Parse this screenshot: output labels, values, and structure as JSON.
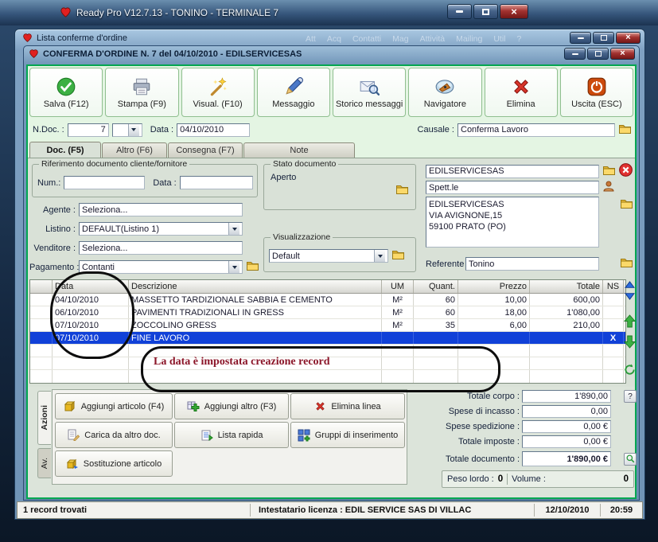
{
  "colors": {
    "accent_green": "#00a651",
    "selected_row": "#1141d8",
    "annotation_red": "#8b1528"
  },
  "outer_window": {
    "title": "Ready Pro V12.7.13 - TONINO - TERMINALE 7"
  },
  "list_window": {
    "title": "Lista conferme d'ordine",
    "ghost_menu": [
      "Att",
      "Acq",
      "Contatti",
      "Mag",
      "Attività",
      "Mailing",
      "Util",
      "?"
    ]
  },
  "doc_window": {
    "title": "CONFERMA D'ORDINE N. 7  del 04/10/2010 - EDILSERVICESAS"
  },
  "toolbar": {
    "buttons": [
      {
        "label": "Salva (F12)",
        "icon": "save-check-icon"
      },
      {
        "label": "Stampa (F9)",
        "icon": "printer-icon"
      },
      {
        "label": "Visual. (F10)",
        "icon": "magic-wand-icon"
      },
      {
        "label": "Messaggio",
        "icon": "pencil-icon"
      },
      {
        "label": "Storico messaggi",
        "icon": "mail-search-icon"
      },
      {
        "label": "Navigatore",
        "icon": "compass-icon"
      },
      {
        "label": "Elimina",
        "icon": "delete-x-icon"
      },
      {
        "label": "Uscita (ESC)",
        "icon": "power-icon"
      }
    ]
  },
  "doc_header": {
    "ndoc_label": "N.Doc. :",
    "ndoc_value": "7",
    "data_label": "Data :",
    "data_value": "04/10/2010",
    "causale_label": "Causale :",
    "causale_value": "Conferma Lavoro"
  },
  "tabs": [
    {
      "label": "Doc. (F5)"
    },
    {
      "label": "Altro (F6)"
    },
    {
      "label": "Consegna (F7)"
    },
    {
      "label": "Note"
    }
  ],
  "form": {
    "riferimento_legend": "Riferimento documento cliente/fornitore",
    "num_label": "Num.:",
    "num_value": "",
    "rif_data_label": "Data :",
    "rif_data_value": "",
    "agente_label": "Agente :",
    "agente_value": "Seleziona...",
    "listino_label": "Listino :",
    "listino_value": "DEFAULT(Listino 1)",
    "venditore_label": "Venditore :",
    "venditore_value": "Seleziona...",
    "pagamento_label": "Pagamento :",
    "pagamento_value": "Contanti",
    "stato_legend": "Stato documento",
    "stato_value": "Aperto",
    "visualizzazione_legend": "Visualizzazione",
    "visualizzazione_value": "Default",
    "cliente_name": "EDILSERVICESAS",
    "spettle": "Spett.le",
    "address_lines": [
      "EDILSERVICESAS",
      "VIA AVIGNONE,15",
      "59100 PRATO (PO)"
    ],
    "referente_label": "Referente",
    "referente_value": "Tonino"
  },
  "grid": {
    "columns": [
      "Data",
      "Descrizione",
      "UM",
      "Quant.",
      "Prezzo",
      "Totale",
      "NS"
    ],
    "rows": [
      {
        "data": "04/10/2010",
        "descrizione": "MASSETTO TARDIZIONALE SABBIA E CEMENTO",
        "um": "M²",
        "quant": "60",
        "prezzo": "10,00",
        "totale": "600,00",
        "ns": ""
      },
      {
        "data": "06/10/2010",
        "descrizione": "PAVIMENTI TRADIZIONALI IN GRESS",
        "um": "M²",
        "quant": "60",
        "prezzo": "18,00",
        "totale": "1'080,00",
        "ns": ""
      },
      {
        "data": "07/10/2010",
        "descrizione": "ZOCCOLINO GRESS",
        "um": "M²",
        "quant": "35",
        "prezzo": "6,00",
        "totale": "210,00",
        "ns": ""
      },
      {
        "data": "07/10/2010",
        "descrizione": "FINE LAVORO",
        "um": "",
        "quant": "",
        "prezzo": "",
        "totale": "",
        "ns": "X"
      }
    ]
  },
  "annotation": {
    "text": "La data è impostata creazione record"
  },
  "actions": {
    "tab_azioni": "Azioni",
    "tab_av": "Av.",
    "buttons": [
      {
        "label": "Aggiungi articolo (F4)",
        "icon": "package-icon"
      },
      {
        "label": "Aggiungi altro (F3)",
        "icon": "add-grid-icon"
      },
      {
        "label": "Elimina linea",
        "icon": "delete-x-icon"
      },
      {
        "label": "Carica da altro doc.",
        "icon": "document-load-icon"
      },
      {
        "label": "Lista rapida",
        "icon": "quick-list-icon"
      },
      {
        "label": "Gruppi di inserimento",
        "icon": "insert-group-icon"
      },
      {
        "label": "Sostituzione articolo",
        "icon": "replace-package-icon"
      }
    ]
  },
  "totals": {
    "rows": [
      {
        "label": "Totale corpo :",
        "value": "1'890,00"
      },
      {
        "label": "Spese di incasso :",
        "value": "0,00"
      },
      {
        "label": "Spese spedizione :",
        "value": "0,00 €"
      },
      {
        "label": "Totale imposte :",
        "value": "0,00 €"
      },
      {
        "label": "Totale documento :",
        "value": "1'890,00 €"
      }
    ],
    "help_label": "?",
    "peso_label": "Peso lordo :",
    "peso_value": "0",
    "volume_label": "Volume :",
    "volume_value": "0"
  },
  "statusbar": {
    "left": "1 record trovati",
    "license": "Intestatario licenza : EDIL SERVICE SAS DI VILLAC",
    "date": "12/10/2010",
    "time": "20:59"
  }
}
